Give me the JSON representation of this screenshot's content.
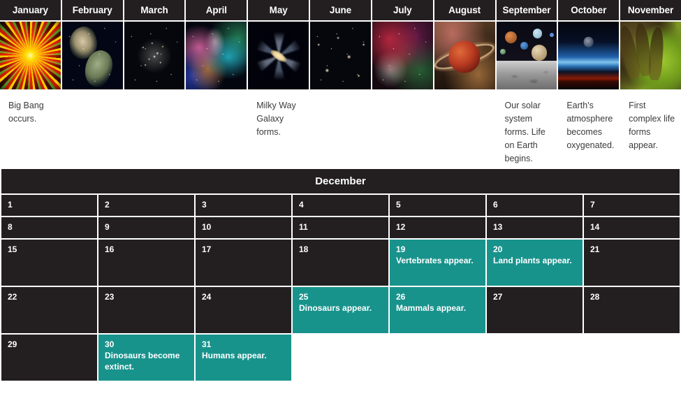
{
  "months": [
    {
      "name": "January",
      "image": "big-bang-explosion-image",
      "caption": "Big Bang occurs."
    },
    {
      "name": "February",
      "image": "nebula-pillar-image",
      "caption": ""
    },
    {
      "name": "March",
      "image": "star-cluster-image",
      "caption": ""
    },
    {
      "name": "April",
      "image": "galaxy-cluster-image",
      "caption": ""
    },
    {
      "name": "May",
      "image": "spiral-galaxy-image",
      "caption": "Milky Way Galaxy forms."
    },
    {
      "name": "June",
      "image": "deep-field-galaxies-image",
      "caption": ""
    },
    {
      "name": "July",
      "image": "emission-nebula-image",
      "caption": ""
    },
    {
      "name": "August",
      "image": "ringed-planet-image",
      "caption": ""
    },
    {
      "name": "September",
      "image": "solar-system-planets-image",
      "caption": "Our solar system forms. Life on Earth begins."
    },
    {
      "name": "October",
      "image": "earth-atmosphere-limb-image",
      "caption": "Earth's atmosphere becomes oxygenated."
    },
    {
      "name": "November",
      "image": "algae-complex-life-image",
      "caption": "First complex life forms appear."
    }
  ],
  "december": {
    "title": "December",
    "weeks": [
      [
        {
          "day": "1",
          "event": ""
        },
        {
          "day": "2",
          "event": ""
        },
        {
          "day": "3",
          "event": ""
        },
        {
          "day": "4",
          "event": ""
        },
        {
          "day": "5",
          "event": ""
        },
        {
          "day": "6",
          "event": ""
        },
        {
          "day": "7",
          "event": ""
        }
      ],
      [
        {
          "day": "8",
          "event": ""
        },
        {
          "day": "9",
          "event": ""
        },
        {
          "day": "10",
          "event": ""
        },
        {
          "day": "11",
          "event": ""
        },
        {
          "day": "12",
          "event": ""
        },
        {
          "day": "13",
          "event": ""
        },
        {
          "day": "14",
          "event": ""
        }
      ],
      [
        {
          "day": "15",
          "event": ""
        },
        {
          "day": "16",
          "event": ""
        },
        {
          "day": "17",
          "event": ""
        },
        {
          "day": "18",
          "event": ""
        },
        {
          "day": "19",
          "event": "Vertebrates appear."
        },
        {
          "day": "20",
          "event": "Land plants appear."
        },
        {
          "day": "21",
          "event": ""
        }
      ],
      [
        {
          "day": "22",
          "event": ""
        },
        {
          "day": "23",
          "event": ""
        },
        {
          "day": "24",
          "event": ""
        },
        {
          "day": "25",
          "event": "Dinosaurs appear."
        },
        {
          "day": "26",
          "event": "Mammals appear."
        },
        {
          "day": "27",
          "event": ""
        },
        {
          "day": "28",
          "event": ""
        }
      ],
      [
        {
          "day": "29",
          "event": ""
        },
        {
          "day": "30",
          "event": "Dinosaurs become extinct."
        },
        {
          "day": "31",
          "event": "Humans appear."
        },
        {
          "day": "",
          "event": ""
        },
        {
          "day": "",
          "event": ""
        },
        {
          "day": "",
          "event": ""
        },
        {
          "day": "",
          "event": ""
        }
      ]
    ]
  },
  "colors": {
    "header_dark": "#231f20",
    "event_teal": "#18938c",
    "page_background": "#ffffff",
    "caption_text": "#3b3b3b"
  }
}
